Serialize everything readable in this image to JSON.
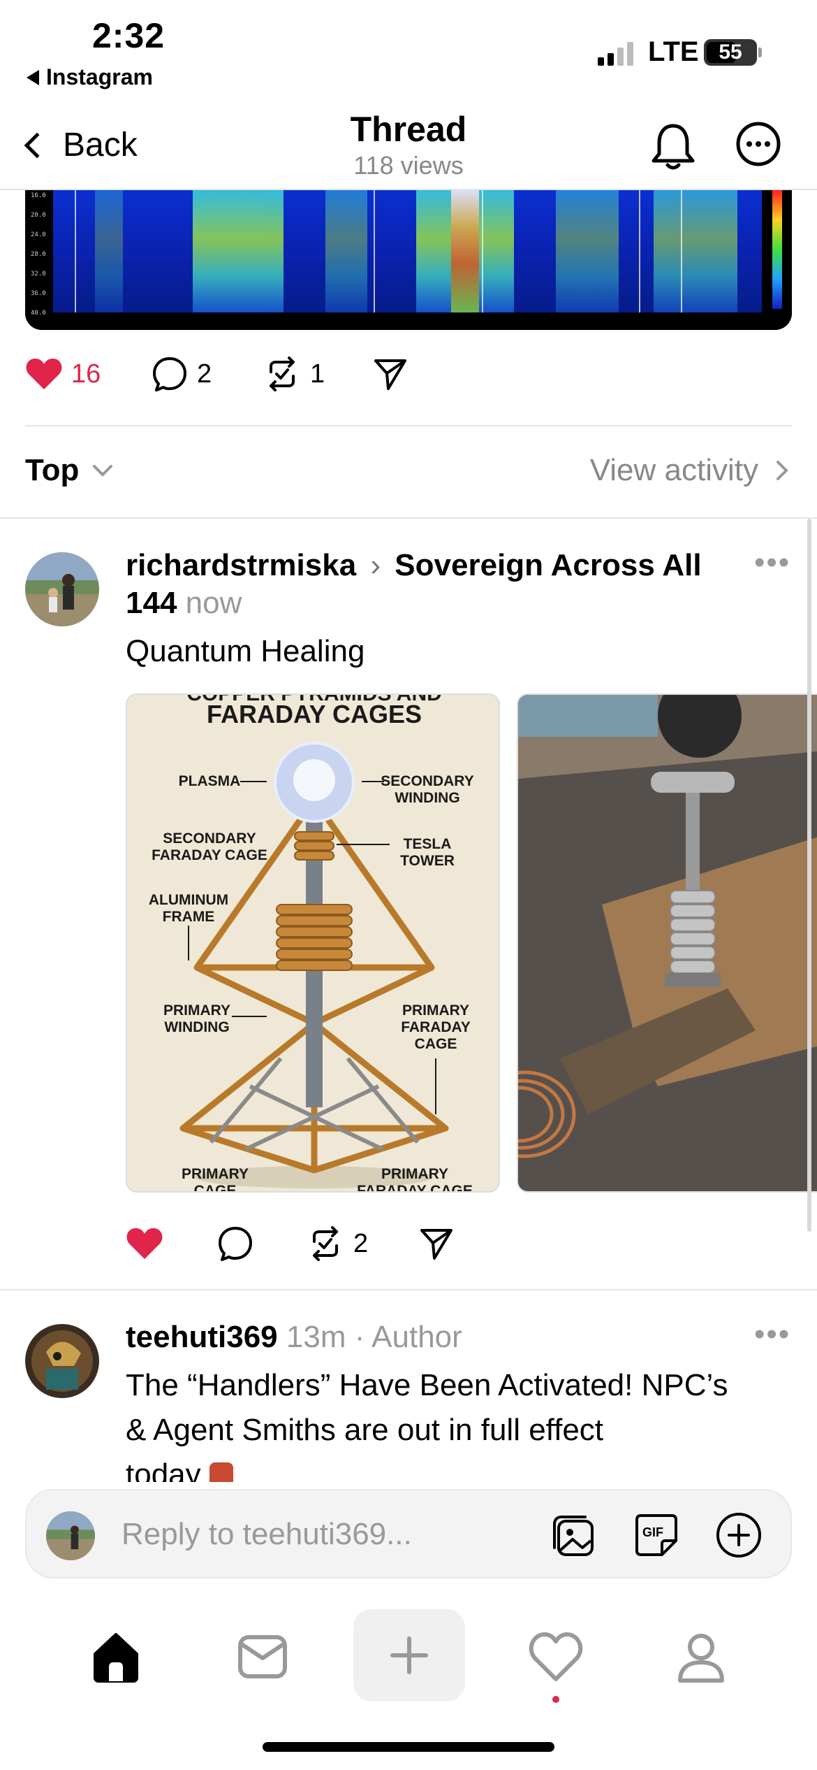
{
  "status_bar": {
    "time": "2:32",
    "back_app": "Instagram",
    "network": "LTE",
    "battery": "55"
  },
  "header": {
    "back_label": "Back",
    "title": "Thread",
    "views": "118 views"
  },
  "main_post": {
    "likes": "16",
    "comments": "2",
    "reposts": "1"
  },
  "sort": {
    "label": "Top",
    "view_activity": "View activity"
  },
  "reply1": {
    "username": "richardstrmiska",
    "community": "Sovereign Across All 144",
    "time": "now",
    "text": "Quantum Healing",
    "diagram": {
      "title_top": "COPPER PYRAMIDS AND",
      "title": "FARADAY CAGES",
      "labels": {
        "plasma": "PLASMA",
        "secondary_winding_1": "SECONDARY",
        "secondary_winding_2": "WINDING",
        "secondary_cage_1": "SECONDARY",
        "secondary_cage_2": "FARADAY CAGE",
        "tesla_1": "TESLA",
        "tesla_2": "TOWER",
        "aluminum_1": "ALUMINUM",
        "aluminum_2": "FRAME",
        "primary_winding_1": "PRIMARY",
        "primary_winding_2": "WINDING",
        "primary_cage_r1": "PRIMARY",
        "primary_cage_r2": "FARADAY",
        "primary_cage_r3": "CAGE",
        "bottom_left_1": "PRIMARY",
        "bottom_left_2": "CAGE",
        "bottom_right_1": "PRIMARY",
        "bottom_right_2": "FARADAY CAGE"
      }
    },
    "reposts": "2"
  },
  "reply2": {
    "username": "teehuti369",
    "time": "13m",
    "badge": "Author",
    "text_line1": "The “Handlers” Have Been Activated! NPC’s",
    "text_line2": "& Agent Smiths are out in full effect",
    "text_line3": "today"
  },
  "composer": {
    "placeholder": "Reply to teehuti369..."
  },
  "colors": {
    "like_red": "#e0244a",
    "muted": "#999999"
  }
}
